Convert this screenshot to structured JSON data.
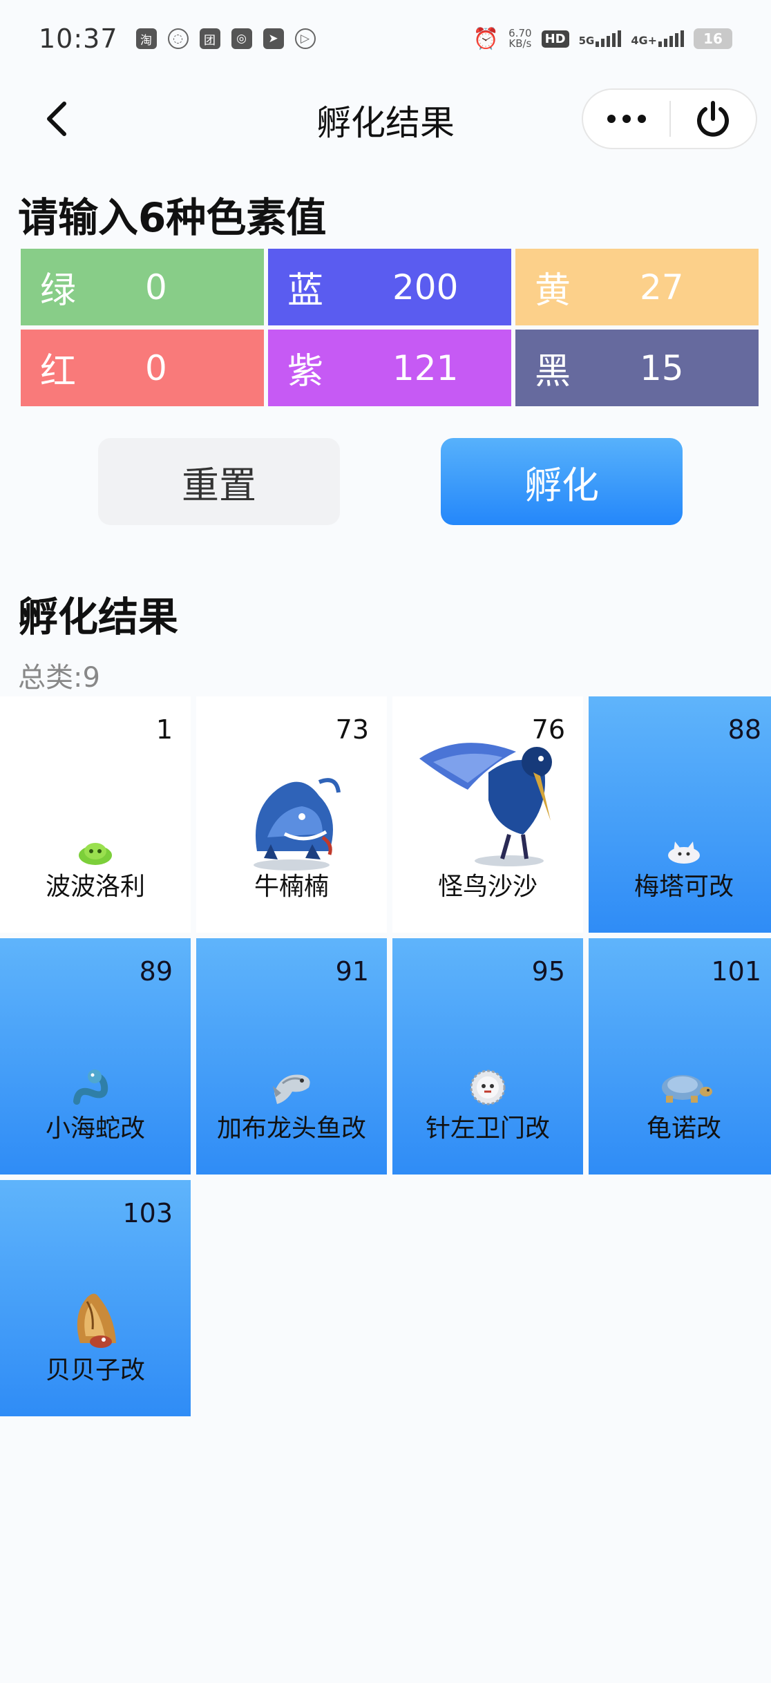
{
  "status_bar": {
    "time": "10:37",
    "apps": [
      "淘",
      "团"
    ],
    "net_speed_value": "6.70",
    "net_speed_unit": "KB/s",
    "hd_label": "HD",
    "sim1_label": "5G",
    "sim2_label": "4G+",
    "battery": "16"
  },
  "nav": {
    "title": "孵化结果"
  },
  "input_section": {
    "heading": "请输入6种色素值",
    "pigments": [
      {
        "name": "绿",
        "value": "0",
        "color": "#88cd88"
      },
      {
        "name": "蓝",
        "value": "200",
        "color": "#5a5cf0"
      },
      {
        "name": "黄",
        "value": "27",
        "color": "#fcd08a"
      },
      {
        "name": "红",
        "value": "0",
        "color": "#f97a7a"
      },
      {
        "name": "紫",
        "value": "121",
        "color": "#c65af4"
      },
      {
        "name": "黑",
        "value": "15",
        "color": "#666a9e"
      }
    ]
  },
  "actions": {
    "reset_label": "重置",
    "hatch_label": "孵化"
  },
  "result_section": {
    "heading": "孵化结果",
    "total": "总类:9",
    "items": [
      {
        "number": "1",
        "name": "波波洛利",
        "style": "white",
        "icon": "green-slime-icon"
      },
      {
        "number": "73",
        "name": "牛楠楠",
        "style": "white",
        "icon": "blue-monster-icon"
      },
      {
        "number": "76",
        "name": "怪鸟沙沙",
        "style": "white",
        "icon": "blue-bird-icon"
      },
      {
        "number": "88",
        "name": "梅塔可改",
        "style": "blue",
        "icon": "white-blob-icon"
      },
      {
        "number": "89",
        "name": "小海蛇改",
        "style": "blue",
        "icon": "sea-snake-icon"
      },
      {
        "number": "91",
        "name": "加布龙头鱼改",
        "style": "blue",
        "icon": "dragon-fish-icon"
      },
      {
        "number": "95",
        "name": "针左卫门改",
        "style": "blue",
        "icon": "spiky-ball-icon"
      },
      {
        "number": "101",
        "name": "龟诺改",
        "style": "blue",
        "icon": "turtle-icon"
      },
      {
        "number": "103",
        "name": "贝贝子改",
        "style": "blue",
        "icon": "hermit-shell-icon"
      }
    ]
  }
}
